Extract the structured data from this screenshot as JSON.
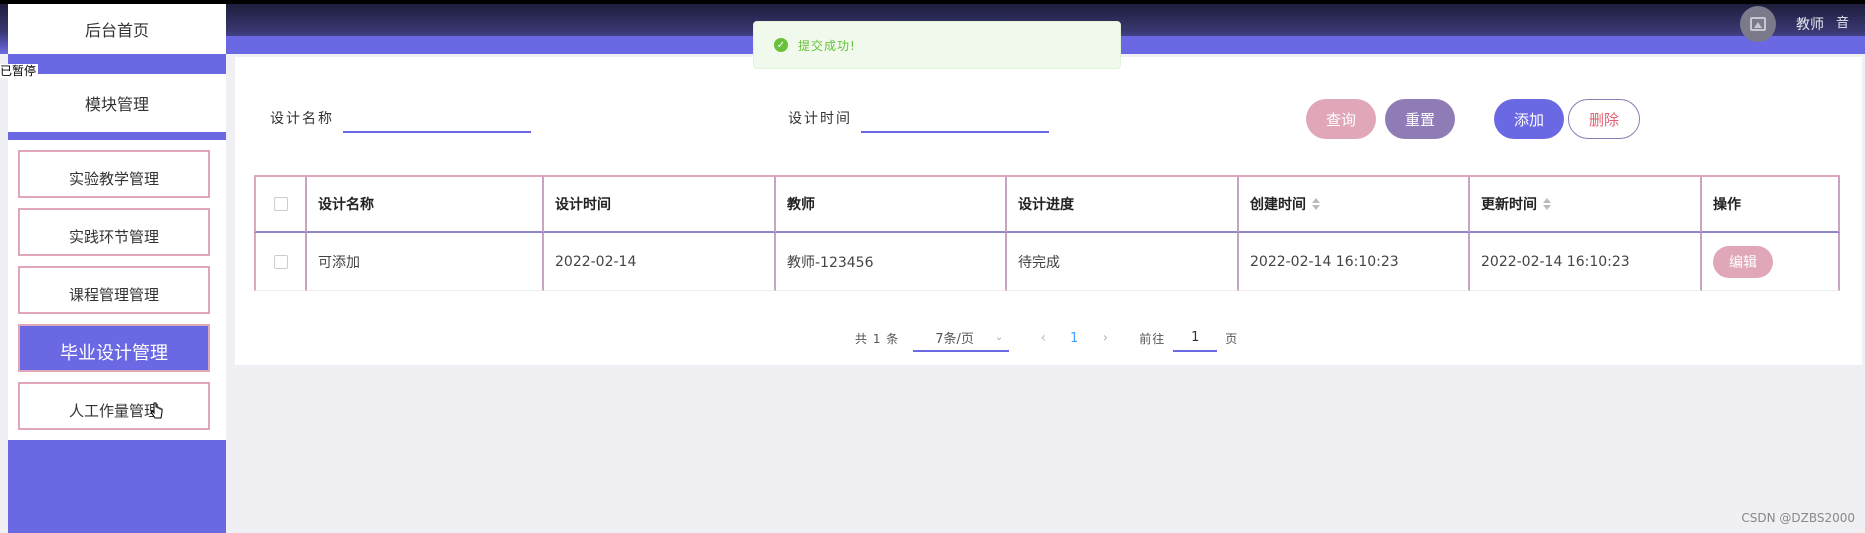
{
  "sidebar": {
    "home": "后台首页",
    "module": "模块管理",
    "tiny_label": "已暂停",
    "items": [
      {
        "label": "实验教学管理"
      },
      {
        "label": "实践环节管理"
      },
      {
        "label": "课程管理管理"
      },
      {
        "label": "毕业设计管理"
      },
      {
        "label": "人工作量管理"
      }
    ]
  },
  "header": {
    "user_name": "教师",
    "user_extra": "音"
  },
  "toast": {
    "text": "提交成功!"
  },
  "search": {
    "name_label": "设计名称",
    "name_value": "",
    "time_label": "设计时间",
    "time_value": "",
    "query_label": "查询",
    "reset_label": "重置",
    "add_label": "添加",
    "delete_label": "删除"
  },
  "table": {
    "headers": [
      "设计名称",
      "设计时间",
      "教师",
      "设计进度",
      "创建时间",
      "更新时间",
      "操作"
    ],
    "rows": [
      {
        "name": "可添加",
        "time": "2022-02-14",
        "teacher": "教师-123456",
        "progress": "待完成",
        "created": "2022-02-14 16:10:23",
        "updated": "2022-02-14 16:10:23",
        "action": "编辑"
      }
    ]
  },
  "pagination": {
    "total": "共 1 条",
    "page_size": "7条/页",
    "prev": "‹",
    "current_page": "1",
    "next": "›",
    "goto_label": "前往",
    "goto_value": "1",
    "goto_unit": "页"
  },
  "watermark": "CSDN @DZBS2000",
  "colors": {
    "primary": "#6a68e3",
    "pink": "#e0a7b8",
    "purple": "#8f7bb5",
    "success": "#67c23a"
  }
}
